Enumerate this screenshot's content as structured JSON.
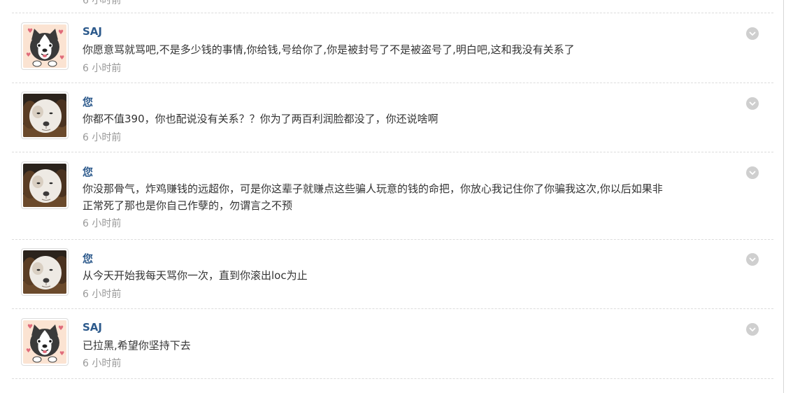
{
  "top_stub_time": "6 小时前",
  "messages": [
    {
      "sender": "SAJ",
      "avatar": "cartoon-dog-icon",
      "text": "你愿意骂就骂吧,不是多少钱的事情,你给钱,号给你了,你是被封号了不是被盗号了,明白吧,这和我没有关系了",
      "time": "6 小时前"
    },
    {
      "sender": "您",
      "avatar": "puppy-photo-icon",
      "text": "你都不值390，你也配说没有关系？？你为了两百利润脸都没了，你还说啥啊",
      "time": "6 小时前"
    },
    {
      "sender": "您",
      "avatar": "puppy-photo-icon",
      "text": "你没那骨气，炸鸡赚钱的远超你，可是你这辈子就赚点这些骗人玩意的钱的命把，你放心我记住你了你骗我这次,你以后如果非正常死了那也是你自己作孽的，勿谓言之不预",
      "time": "6 小时前"
    },
    {
      "sender": "您",
      "avatar": "puppy-photo-icon",
      "text": "从今天开始我每天骂你一次，直到你滚出loc为止",
      "time": "6 小时前"
    },
    {
      "sender": "SAJ",
      "avatar": "cartoon-dog-icon",
      "text": "已拉黑,希望你坚持下去",
      "time": "6 小时前"
    }
  ],
  "colors": {
    "name": "#2d5a8c",
    "text": "#333333",
    "time": "#999999",
    "separator": "#dcdcdc",
    "menu_button": "#cfcfcf"
  }
}
